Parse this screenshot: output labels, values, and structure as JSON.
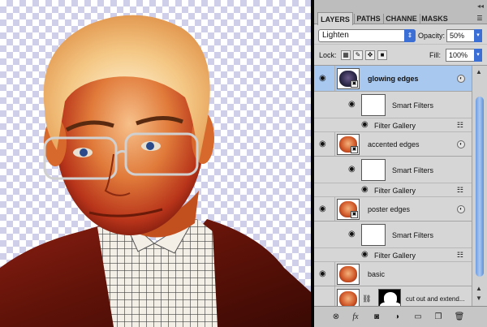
{
  "panel": {
    "tabs": [
      "LAYERS",
      "PATHS",
      "CHANNELS",
      "MASKS"
    ],
    "tabs_display": [
      "LAYERS",
      "PATHS",
      "CHANNE",
      "MASKS"
    ],
    "blend_mode": "Lighten",
    "opacity_label": "Opacity:",
    "opacity_value": "50%",
    "lock_label": "Lock:",
    "fill_label": "Fill:",
    "fill_value": "100%"
  },
  "layers": [
    {
      "name": "glowing edges",
      "selected": true,
      "smart_filters_label": "Smart Filters",
      "filter_label": "Filter Gallery"
    },
    {
      "name": "accented edges",
      "selected": false,
      "smart_filters_label": "Smart Filters",
      "filter_label": "Filter Gallery"
    },
    {
      "name": "poster edges",
      "selected": false,
      "smart_filters_label": "Smart Filters",
      "filter_label": "Filter Gallery"
    },
    {
      "name": "basic",
      "selected": false
    },
    {
      "name": "cut out and extend...",
      "selected": false
    }
  ],
  "colors": {
    "selection": "#a8c8ef",
    "scroll_thumb": "#6e9de0",
    "checker": "#cfcfe9"
  },
  "icons": [
    "eye-icon",
    "smart-object-icon",
    "fx-icon",
    "link-icon",
    "add-mask-icon",
    "adjustment-icon",
    "folder-icon",
    "new-layer-icon",
    "trash-icon",
    "panel-menu-icon"
  ]
}
